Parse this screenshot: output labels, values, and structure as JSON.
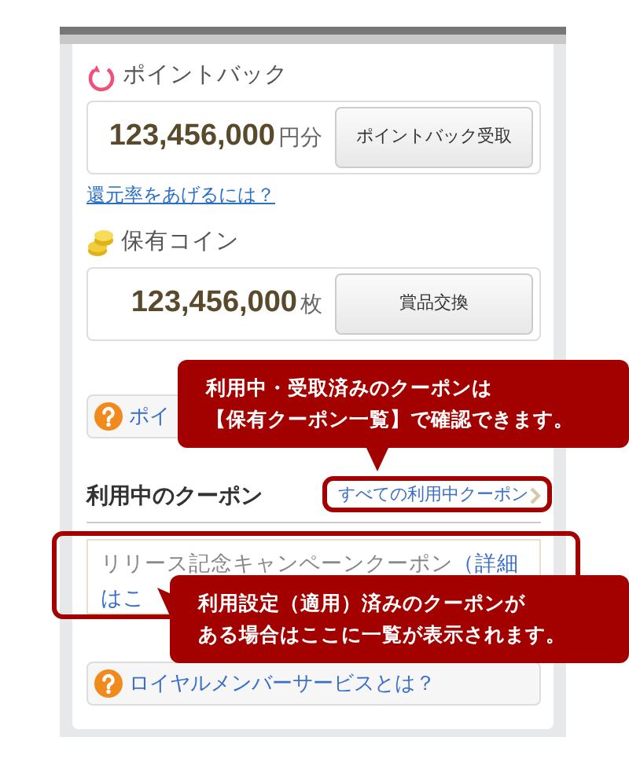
{
  "point_back": {
    "title": "ポイントバック",
    "amount": "123,456,000",
    "unit": "円分",
    "button": "ポイントバック受取",
    "link": "還元率をあげるには？"
  },
  "coins": {
    "title": "保有コイン",
    "amount": "123,456,000",
    "unit": "枚",
    "button": "賞品交換"
  },
  "help_top": {
    "label": "ポイ"
  },
  "coupons": {
    "title": "利用中のクーポン",
    "all_link": "すべての利用中クーポン",
    "items": [
      {
        "name": "リリース記念キャンペーンクーポン",
        "detail_link": "（詳細",
        "detail_link_2": "はこ"
      }
    ]
  },
  "help_bottom": {
    "label": "ロイヤルメンバーサービスとは？"
  },
  "callouts": [
    {
      "lines": [
        "利用中・受取済みのクーポンは",
        "【保有クーポン一覧】で確認できます。"
      ]
    },
    {
      "lines": [
        "利用設定（適用）済みのクーポンが",
        "ある場合はここに一覧が表示されます。"
      ]
    }
  ]
}
